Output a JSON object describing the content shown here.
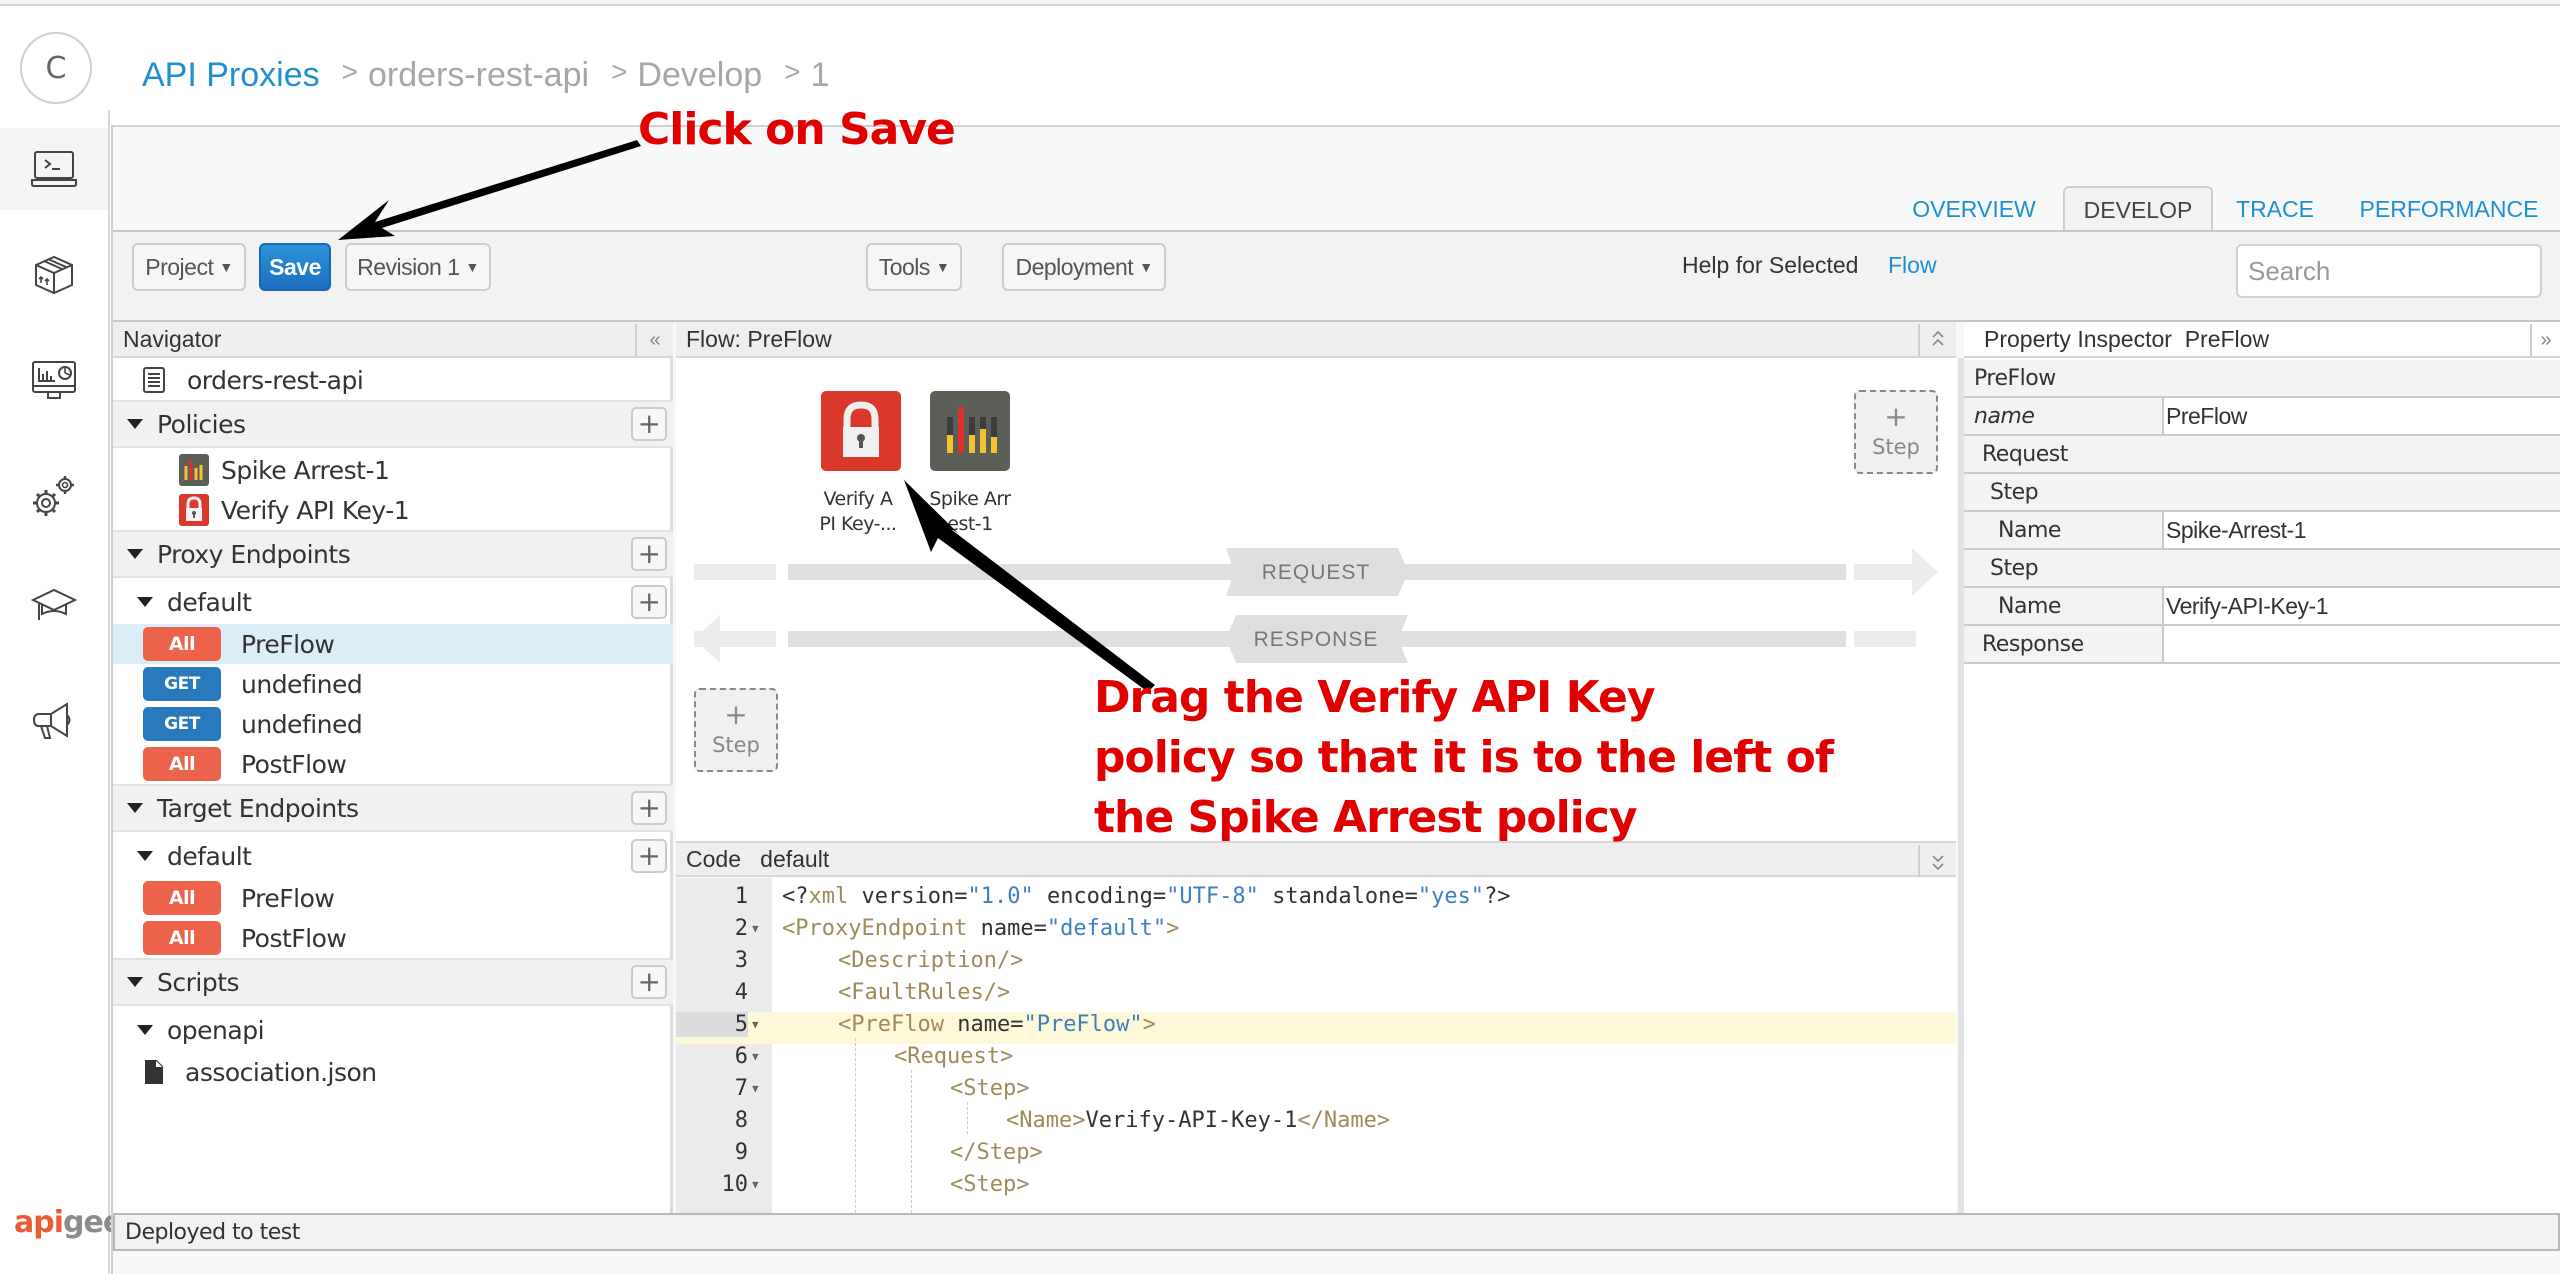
{
  "header": {
    "avatar_initial": "C",
    "breadcrumb": [
      {
        "label": "API Proxies",
        "link": true
      },
      {
        "label": "orders-rest-api",
        "link": false
      },
      {
        "label": "Develop",
        "link": false
      },
      {
        "label": "1",
        "link": false
      }
    ],
    "separator": ">"
  },
  "left_nav": {
    "items": [
      {
        "icon": "terminal-laptop-icon",
        "active": true
      },
      {
        "icon": "package-box-icon",
        "active": false
      },
      {
        "icon": "analytics-monitor-icon",
        "active": false
      },
      {
        "icon": "gears-icon",
        "active": false
      },
      {
        "icon": "graduation-cap-icon",
        "active": false
      },
      {
        "icon": "megaphone-icon",
        "active": false
      }
    ],
    "logo": {
      "part1": "api",
      "part2": "gee"
    }
  },
  "tabs": [
    {
      "label": "OVERVIEW",
      "active": false
    },
    {
      "label": "DEVELOP",
      "active": true
    },
    {
      "label": "TRACE",
      "active": false
    },
    {
      "label": "PERFORMANCE",
      "active": false
    }
  ],
  "toolbar": {
    "project_label": "Project",
    "save_label": "Save",
    "revision_label": "Revision 1",
    "tools_label": "Tools",
    "deployment_label": "Deployment",
    "help_label": "Help for Selected",
    "help_link": "Flow",
    "search_placeholder": "Search"
  },
  "navigator": {
    "title": "Navigator",
    "collapse_glyph": "«",
    "proxy_name": "orders-rest-api",
    "policies_label": "Policies",
    "policies": [
      {
        "name": "Spike Arrest-1",
        "icon": "spike-arrest-icon"
      },
      {
        "name": "Verify API Key-1",
        "icon": "verify-api-key-icon"
      }
    ],
    "proxy_endpoints_label": "Proxy Endpoints",
    "proxy_default_label": "default",
    "proxy_flows": [
      {
        "verb": "All",
        "name": "PreFlow",
        "selected": true
      },
      {
        "verb": "GET",
        "name": "undefined",
        "selected": false
      },
      {
        "verb": "GET",
        "name": "undefined",
        "selected": false
      },
      {
        "verb": "All",
        "name": "PostFlow",
        "selected": false
      }
    ],
    "target_endpoints_label": "Target Endpoints",
    "target_default_label": "default",
    "target_flows": [
      {
        "verb": "All",
        "name": "PreFlow"
      },
      {
        "verb": "All",
        "name": "PostFlow"
      }
    ],
    "scripts_label": "Scripts",
    "scripts_folder": "openapi",
    "scripts_file": "association.json"
  },
  "flow": {
    "title": "Flow: PreFlow",
    "policies": [
      {
        "label_line1": "Verify A",
        "label_line2": "PI Key-...",
        "type": "verify-api-key"
      },
      {
        "label_line1": "Spike Arr",
        "label_line2": "est-1",
        "type": "spike-arrest"
      }
    ],
    "step_label": "Step",
    "request_label": "REQUEST",
    "response_label": "RESPONSE"
  },
  "code": {
    "title": "Code",
    "subtitle": "default",
    "lines": [
      {
        "n": "1",
        "fold": false,
        "indent": 0
      },
      {
        "n": "2",
        "fold": true,
        "indent": 0
      },
      {
        "n": "3",
        "fold": false,
        "indent": 1
      },
      {
        "n": "4",
        "fold": false,
        "indent": 1
      },
      {
        "n": "5",
        "fold": true,
        "indent": 1,
        "highlight": true
      },
      {
        "n": "6",
        "fold": true,
        "indent": 2
      },
      {
        "n": "7",
        "fold": true,
        "indent": 3
      },
      {
        "n": "8",
        "fold": false,
        "indent": 4
      },
      {
        "n": "9",
        "fold": false,
        "indent": 3
      },
      {
        "n": "10",
        "fold": true,
        "indent": 3
      }
    ],
    "tokens": {
      "l1": [
        "<?",
        "xml",
        " version=",
        "\"1.0\"",
        " encoding=",
        "\"UTF-8\"",
        " standalone=",
        "\"yes\"",
        "?>"
      ],
      "l2": [
        "<ProxyEndpoint",
        " name=",
        "\"default\"",
        ">"
      ],
      "l3": [
        "<Description/>"
      ],
      "l4": [
        "<FaultRules/>"
      ],
      "l5": [
        "<PreFlow",
        " name=",
        "\"PreFlow\"",
        ">"
      ],
      "l6": [
        "<Request>"
      ],
      "l7": [
        "<Step>"
      ],
      "l8": [
        "<Name>",
        "Verify-API-Key-1",
        "</Name>"
      ],
      "l9": [
        "</Step>"
      ],
      "l10": [
        "<Step>"
      ]
    }
  },
  "property_inspector": {
    "title": "Property Inspector",
    "subtitle": "PreFlow",
    "expand_glyph": "»",
    "rows": [
      {
        "key": "PreFlow",
        "value": null,
        "level": 0
      },
      {
        "key": "name",
        "value": "PreFlow",
        "level": 0,
        "italic": true
      },
      {
        "key": "Request",
        "value": null,
        "level": 1
      },
      {
        "key": "Step",
        "value": null,
        "level": 2
      },
      {
        "key": "Name",
        "value": "Spike-Arrest-1",
        "level": 3
      },
      {
        "key": "Step",
        "value": null,
        "level": 2
      },
      {
        "key": "Name",
        "value": "Verify-API-Key-1",
        "level": 3
      },
      {
        "key": "Response",
        "value": "",
        "level": 1
      }
    ]
  },
  "status_bar": {
    "text": "Deployed to test"
  },
  "annotations": {
    "save_hint": "Click on Save",
    "drag_hint_line1": "Drag the Verify API Key",
    "drag_hint_line2": "policy so that it is to the left of",
    "drag_hint_line3": "the Spike Arrest policy"
  },
  "colors": {
    "accent_blue": "#1f8fd0",
    "verb_all": "#ec624a",
    "verb_get": "#2979bd",
    "annotation_red": "#e00000",
    "verify_policy": "#d9382b",
    "spike_policy": "#5b5f58"
  }
}
